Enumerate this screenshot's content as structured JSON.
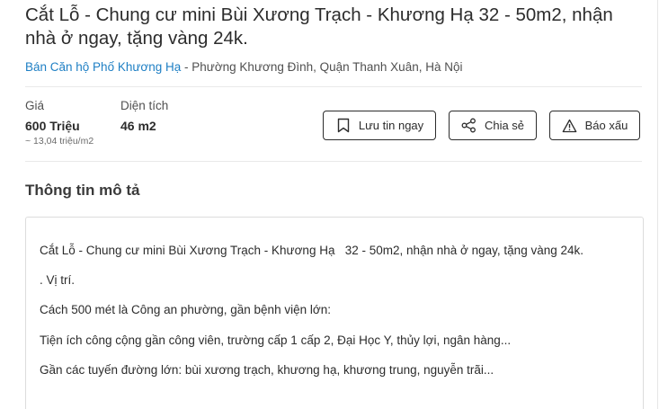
{
  "listing": {
    "title": "Cắt Lỗ - Chung cư mini Bùi Xương Trạch - Khương Hạ 32 - 50m2, nhận nhà ở ngay, tặng vàng 24k.",
    "category_link": "Bán Căn hộ Phố Khương Hạ",
    "location_rest": " - Phường Khương Đình, Quận Thanh Xuân, Hà Nội"
  },
  "specs": {
    "price_label": "Giá",
    "price_value": "600 Triệu",
    "price_per_m2": "~ 13,04 triệu/m2",
    "area_label": "Diện tích",
    "area_value": "46 m2"
  },
  "actions": {
    "save_label": "Lưu tin ngay",
    "share_label": "Chia sẻ",
    "report_label": "Báo xấu",
    "save_icon": "bookmark-icon",
    "share_icon": "share-icon",
    "report_icon": "warning-icon"
  },
  "description": {
    "heading": "Thông tin mô tả",
    "lines": [
      "Cắt Lỗ - Chung cư mini Bùi Xương Trạch - Khương Hạ   32 - 50m2, nhận nhà ở ngay, tặng vàng 24k.",
      ". Vị trí.",
      "Cách 500 mét là Công an phường, gần bệnh viện lớn:",
      "Tiện ích công cộng gần công viên, trường cấp 1 cấp 2, Đại Học Y, thủy lợi, ngân hàng...",
      "Gần các tuyến đường lớn: bùi xương trạch, khương hạ, khương trung, nguyễn trãi..."
    ]
  },
  "colors": {
    "link": "#1e7fc4",
    "text": "#2c2c2c",
    "border": "#dcdcdc"
  }
}
